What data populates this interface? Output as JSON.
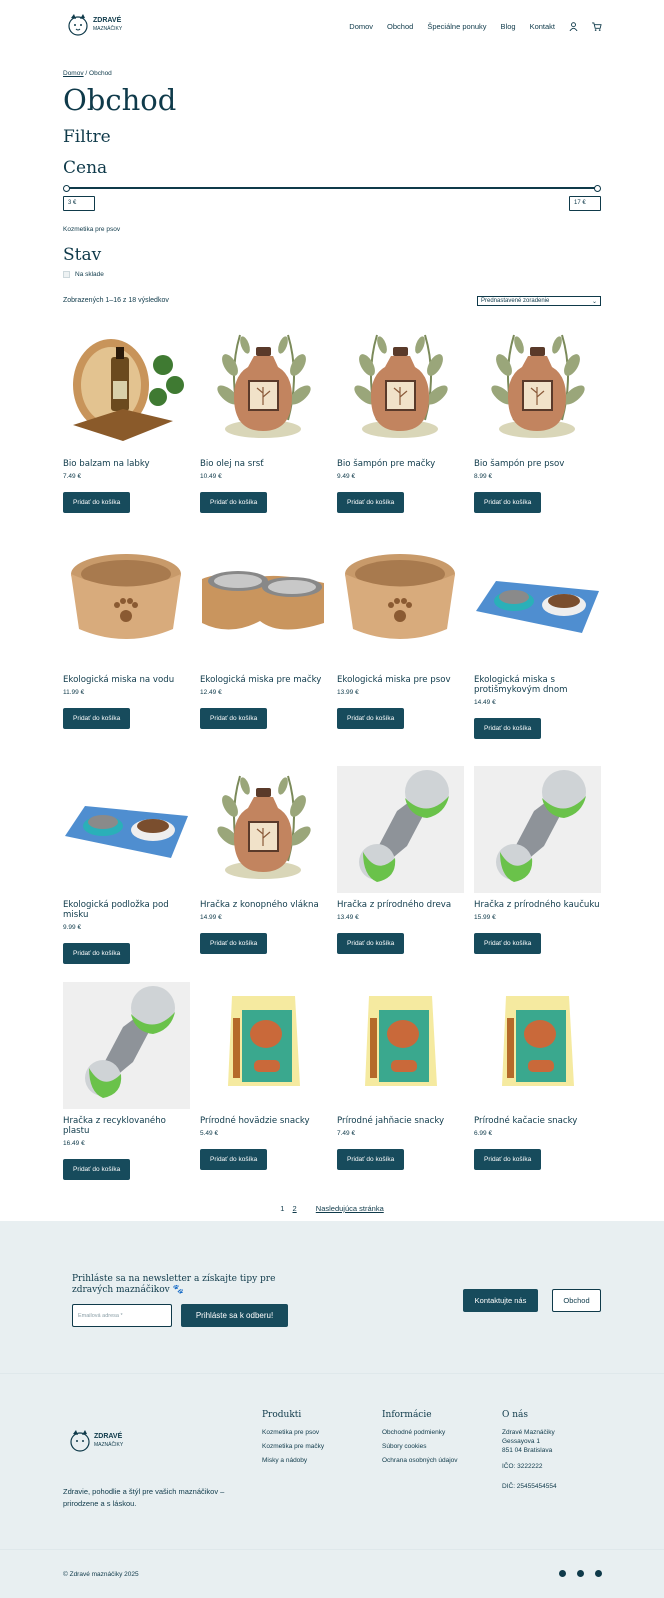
{
  "header": {
    "logo_title": "Zdravé",
    "logo_sub": "Maznáčiky",
    "nav": [
      "Domov",
      "Obchod",
      "Špeciálne ponuky",
      "Blog",
      "Kontakt"
    ]
  },
  "breadcrumb": {
    "home": "Domov",
    "sep": "/",
    "current": "Obchod"
  },
  "page_title": "Obchod",
  "filters": {
    "title": "Filtre",
    "price_title": "Cena",
    "min_price": "3 €",
    "max_price": "17 €",
    "category": "Kozmetika pre psov",
    "state_title": "Stav",
    "in_stock": "Na sklade"
  },
  "results_text": "Zobrazených 1–16 z 18 výsledkov",
  "sort_label": "Prednastavené zoradenie",
  "add_label": "Pridať do košíka",
  "products": [
    {
      "name": "Bio balzam na labky",
      "price": "7.49 €",
      "img": "balm"
    },
    {
      "name": "Bio olej na srsť",
      "price": "10.49 €",
      "img": "bottle"
    },
    {
      "name": "Bio šampón pre mačky",
      "price": "9.49 €",
      "img": "bottle"
    },
    {
      "name": "Bio šampón pre psov",
      "price": "8.99 €",
      "img": "bottle"
    },
    {
      "name": "Ekologická miska na vodu",
      "price": "11.99 €",
      "img": "bowl"
    },
    {
      "name": "Ekologická miska pre mačky",
      "price": "12.49 €",
      "img": "doublebowl"
    },
    {
      "name": "Ekologická miska pre psov",
      "price": "13.99 €",
      "img": "bowl"
    },
    {
      "name": "Ekologická miska s protišmykovým dnom",
      "price": "14.49 €",
      "img": "mat"
    },
    {
      "name": "Ekologická podložka pod misku",
      "price": "9.99 €",
      "img": "mat"
    },
    {
      "name": "Hračka z konopného vlákna",
      "price": "14.99 €",
      "img": "bottle"
    },
    {
      "name": "Hračka z prírodného dreva",
      "price": "13.49 €",
      "img": "toy"
    },
    {
      "name": "Hračka z prírodného kaučuku",
      "price": "15.99 €",
      "img": "toy"
    },
    {
      "name": "Hračka z recyklovaného plastu",
      "price": "16.49 €",
      "img": "toy"
    },
    {
      "name": "Prírodné hovädzie snacky",
      "price": "5.49 €",
      "img": "snack"
    },
    {
      "name": "Prírodné jahňacie snacky",
      "price": "7.49 €",
      "img": "snack"
    },
    {
      "name": "Prírodné kačacie snacky",
      "price": "6.99 €",
      "img": "snack"
    }
  ],
  "pagination": {
    "p1": "1",
    "p2": "2",
    "next": "Nasledujúca stránka"
  },
  "newsletter": {
    "text": "Prihláste sa na newsletter a získajte tipy pre zdravých maznáčikov 🐾",
    "placeholder": "Emailová adresa *",
    "subscribe": "Prihláste sa k odberu!",
    "contact": "Kontaktujte nás",
    "shop": "Obchod"
  },
  "footer": {
    "tagline": "Zdravie, pohodlie a štýl pre vašich maznáčikov – prirodzene a s láskou.",
    "products_title": "Produkti",
    "products_links": [
      "Kozmetika pre psov",
      "Kozmetika pre mačky",
      "Misky a nádoby"
    ],
    "info_title": "Informácie",
    "info_links": [
      "Obchodné podmienky",
      "Súbory cookies",
      "Ochrana osobných údajov"
    ],
    "about_title": "O nás",
    "about_lines": [
      "Zdravé Maznáčiky",
      "Gessayova 1",
      "851 04 Bratislava",
      "",
      "IČO: 3222222",
      "",
      "DIČ: 25455454554"
    ],
    "copyright": "© Zdravé maznáčiky 2025"
  },
  "colors": {
    "primary": "#174b5c",
    "text": "#0f3a4a",
    "bg_light": "#e8eff1"
  }
}
